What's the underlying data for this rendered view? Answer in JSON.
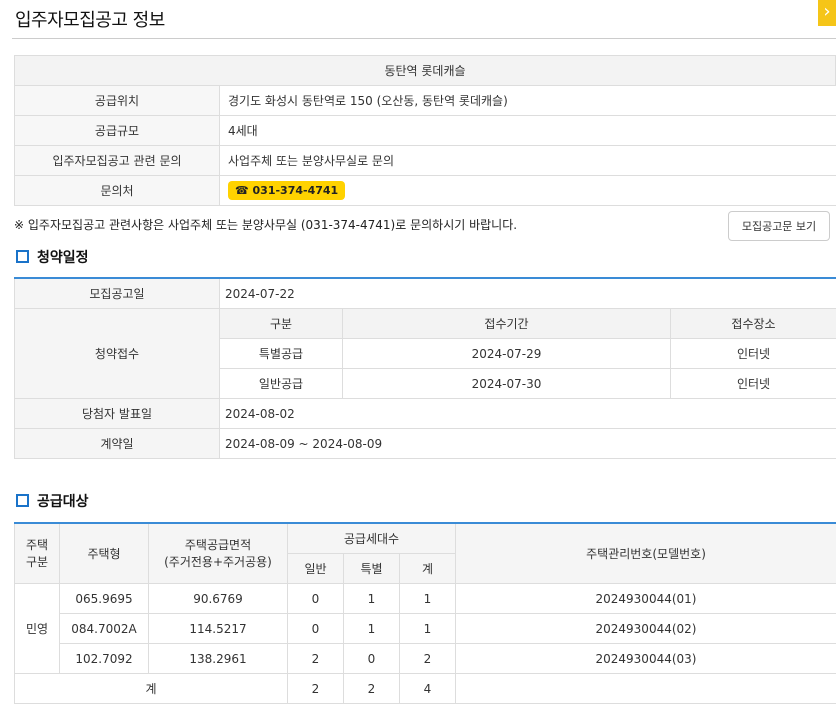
{
  "page": {
    "title": "입주자모집공고 정보",
    "close_icon": "›"
  },
  "info": {
    "name": "동탄역 롯데캐슬",
    "rows": [
      {
        "label": "공급위치",
        "value": "경기도 화성시 동탄역로 150 (오산동, 동탄역 롯데캐슬)"
      },
      {
        "label": "공급규모",
        "value": "4세대"
      },
      {
        "label": "입주자모집공고 관련 문의",
        "value": "사업주체 또는 분양사무실로 문의"
      },
      {
        "label": "문의처",
        "phone": "☎ 031-374-4741"
      }
    ],
    "notice": "※ 입주자모집공고 관련사항은 사업주체 또는 분양사무실 (031-374-4741)로 문의하시기 바랍니다.",
    "notice_button": "모집공고문 보기"
  },
  "schedule": {
    "title": "청약일정",
    "announce_label": "모집공고일",
    "announce_date": "2024-07-22",
    "receipt_label": "청약접수",
    "receipt_headers": [
      "구분",
      "접수기간",
      "접수장소"
    ],
    "receipt_rows": [
      [
        "특별공급",
        "2024-07-29",
        "인터넷"
      ],
      [
        "일반공급",
        "2024-07-30",
        "인터넷"
      ]
    ],
    "winner_label": "당첨자 발표일",
    "winner_date": "2024-08-02",
    "contract_label": "계약일",
    "contract_date": "2024-08-09 ~ 2024-08-09"
  },
  "supply": {
    "title": "공급대상",
    "headers": {
      "type_cat": "주택\n구분",
      "type": "주택형",
      "area": "주택공급면적",
      "area_sub": "(주거전용+주거공용)",
      "households": "공급세대수",
      "general": "일반",
      "special": "특별",
      "total": "계",
      "mgmt": "주택관리번호(모델번호)"
    },
    "category": "민영",
    "rows": [
      [
        "065.9695",
        "90.6769",
        "0",
        "1",
        "1",
        "2024930044(01)"
      ],
      [
        "084.7002A",
        "114.5217",
        "0",
        "1",
        "1",
        "2024930044(02)"
      ],
      [
        "102.7092",
        "138.2961",
        "2",
        "0",
        "2",
        "2024930044(03)"
      ]
    ],
    "total_label": "계",
    "totals": [
      "2",
      "2",
      "4"
    ]
  }
}
